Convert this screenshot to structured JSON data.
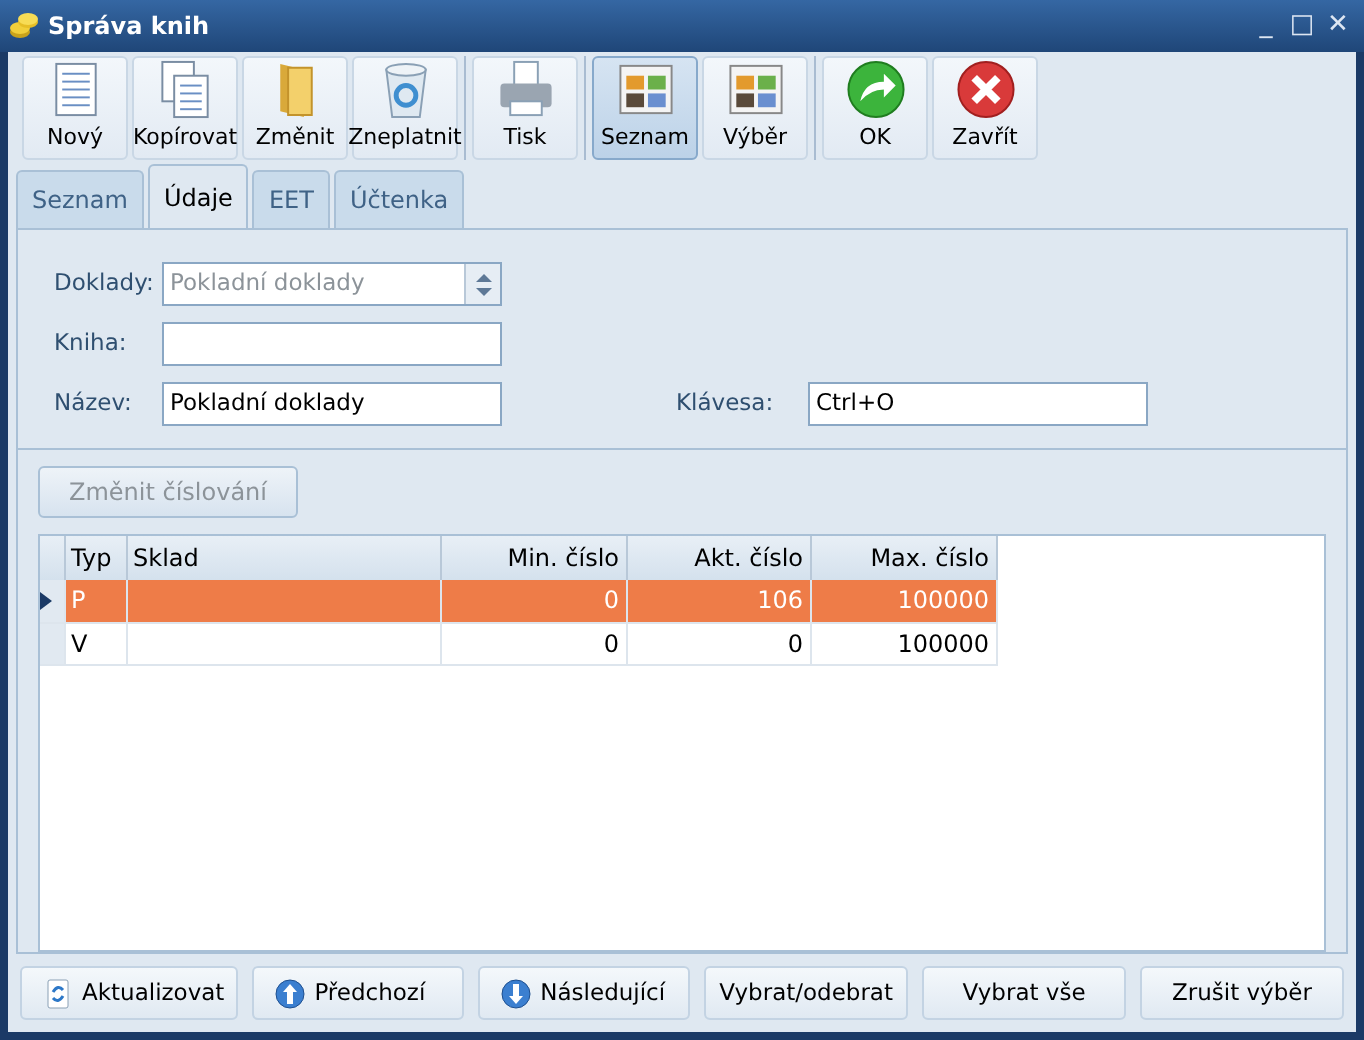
{
  "window": {
    "title": "Správa knih",
    "controls": [
      "_",
      "□",
      "✕"
    ]
  },
  "toolbar": [
    [
      {
        "label": "Nový",
        "selected": false
      },
      {
        "label": "Kopírovat",
        "selected": false
      },
      {
        "label": "Změnit",
        "selected": false
      },
      {
        "label": "Zneplatnit",
        "selected": false
      }
    ],
    [
      {
        "label": "Tisk",
        "selected": false
      }
    ],
    [
      {
        "label": "Seznam",
        "selected": true
      },
      {
        "label": "Výběr",
        "selected": false
      }
    ],
    [
      {
        "label": "OK",
        "selected": false
      },
      {
        "label": "Zavřít",
        "selected": false
      }
    ]
  ],
  "tabs": [
    {
      "label": "Seznam",
      "selected": false
    },
    {
      "label": "Údaje",
      "selected": true
    },
    {
      "label": "EET",
      "selected": false
    },
    {
      "label": "Účtenka",
      "selected": false
    }
  ],
  "form": {
    "doklady": {
      "label": "Doklady:",
      "value": "Pokladní doklady",
      "disabled": true
    },
    "kniha": {
      "label": "Kniha:"
    },
    "nazev": {
      "label": "Název:",
      "value": "Pokladní doklady"
    },
    "klavesa": {
      "label": "Klávesa:",
      "value": "Ctrl+O"
    },
    "renumber_button": {
      "label": "Změnit číslování",
      "disabled": true
    }
  },
  "table": {
    "columns": [
      "Typ",
      "Sklad",
      "Min. číslo",
      "Akt. číslo",
      "Max. číslo"
    ],
    "rows": [
      {
        "cells": [
          "P",
          "",
          "0",
          "106",
          "100000"
        ],
        "selected": true
      },
      {
        "cells": [
          "V",
          "",
          "0",
          "0",
          "100000"
        ],
        "selected": false
      }
    ]
  },
  "bottom_buttons": [
    "Aktualizovat",
    "Předchozí",
    "Následující",
    "Vybrat/odebrat",
    "Vybrat vše",
    "Zrušit výběr"
  ]
}
